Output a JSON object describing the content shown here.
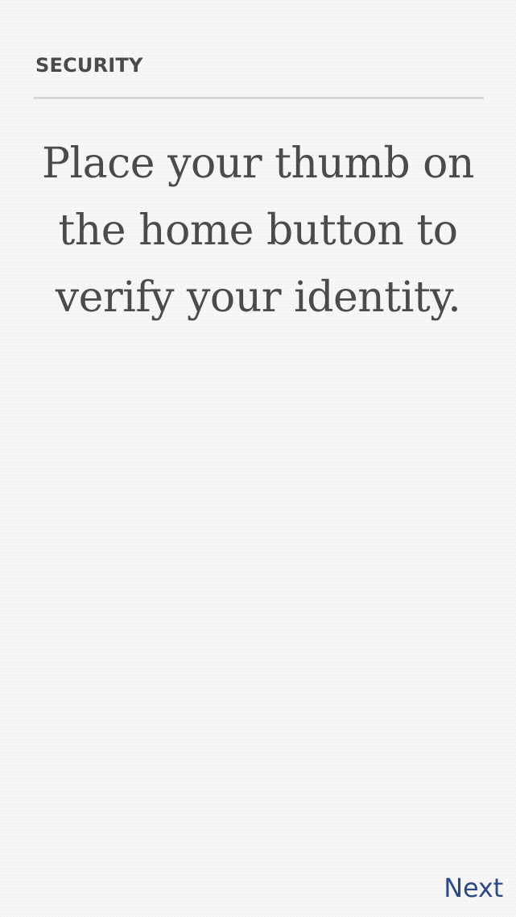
{
  "header": {
    "title": "SECURITY"
  },
  "main": {
    "instruction": "Place your thumb on the home button to verify your identity."
  },
  "footer": {
    "next_label": "Next"
  },
  "colors": {
    "background": "#f7f7f7",
    "text": "#4b4b4b",
    "divider": "#d6d6d6",
    "link": "#2e4a86"
  }
}
